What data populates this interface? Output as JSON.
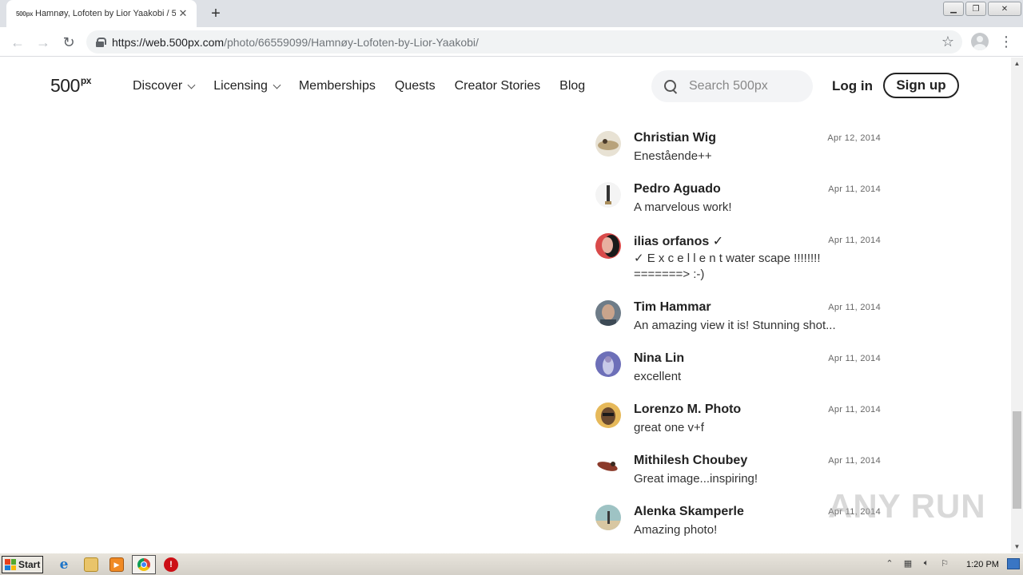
{
  "browser": {
    "tab_title": "Hamnøy, Lofoten by Lior Yaakobi / 5",
    "tab_favicon": "500px",
    "url_host": "https://web.500px.com",
    "url_path": "/photo/66559099/Hamnøy-Lofoten-by-Lior-Yaakobi/"
  },
  "site": {
    "logo": "500",
    "logo_sup": "px",
    "nav": [
      "Discover",
      "Licensing",
      "Memberships",
      "Quests",
      "Creator Stories",
      "Blog"
    ],
    "search_placeholder": "Search 500px",
    "login": "Log in",
    "signup": "Sign up"
  },
  "comments": [
    {
      "name": "Christian Wig",
      "date": "Apr 12, 2014",
      "text": "Enestående++",
      "avatar_color": "#b8a27a"
    },
    {
      "name": "Pedro Aguado",
      "date": "Apr 11, 2014",
      "text": "A marvelous work!",
      "avatar_color": "#e9e9e9"
    },
    {
      "name": "ilias orfanos ✓",
      "date": "Apr 11, 2014",
      "text": "✓ E x c e l l e n t water scape !!!!!!!! =======> :-)",
      "avatar_color": "#c63a3a"
    },
    {
      "name": "Tim Hammar",
      "date": "Apr 11, 2014",
      "text": "An amazing view it is! Stunning shot...",
      "avatar_color": "#6e7c88"
    },
    {
      "name": "Nina Lin",
      "date": "Apr 11, 2014",
      "text": "excellent",
      "avatar_color": "#6d6fb8"
    },
    {
      "name": "Lorenzo M. Photo",
      "date": "Apr 11, 2014",
      "text": "great one v+f",
      "avatar_color": "#d9a441"
    },
    {
      "name": "Mithilesh Choubey",
      "date": "Apr 11, 2014",
      "text": "Great image...inspiring!",
      "avatar_color": "#8b3a2a"
    },
    {
      "name": "Alenka Skamperle",
      "date": "Apr 11, 2014",
      "text": "Amazing photo!",
      "avatar_color": "#9ec3c4"
    }
  ],
  "watermark": "ANY RUN",
  "taskbar": {
    "start": "Start",
    "clock": "1:20 PM"
  }
}
